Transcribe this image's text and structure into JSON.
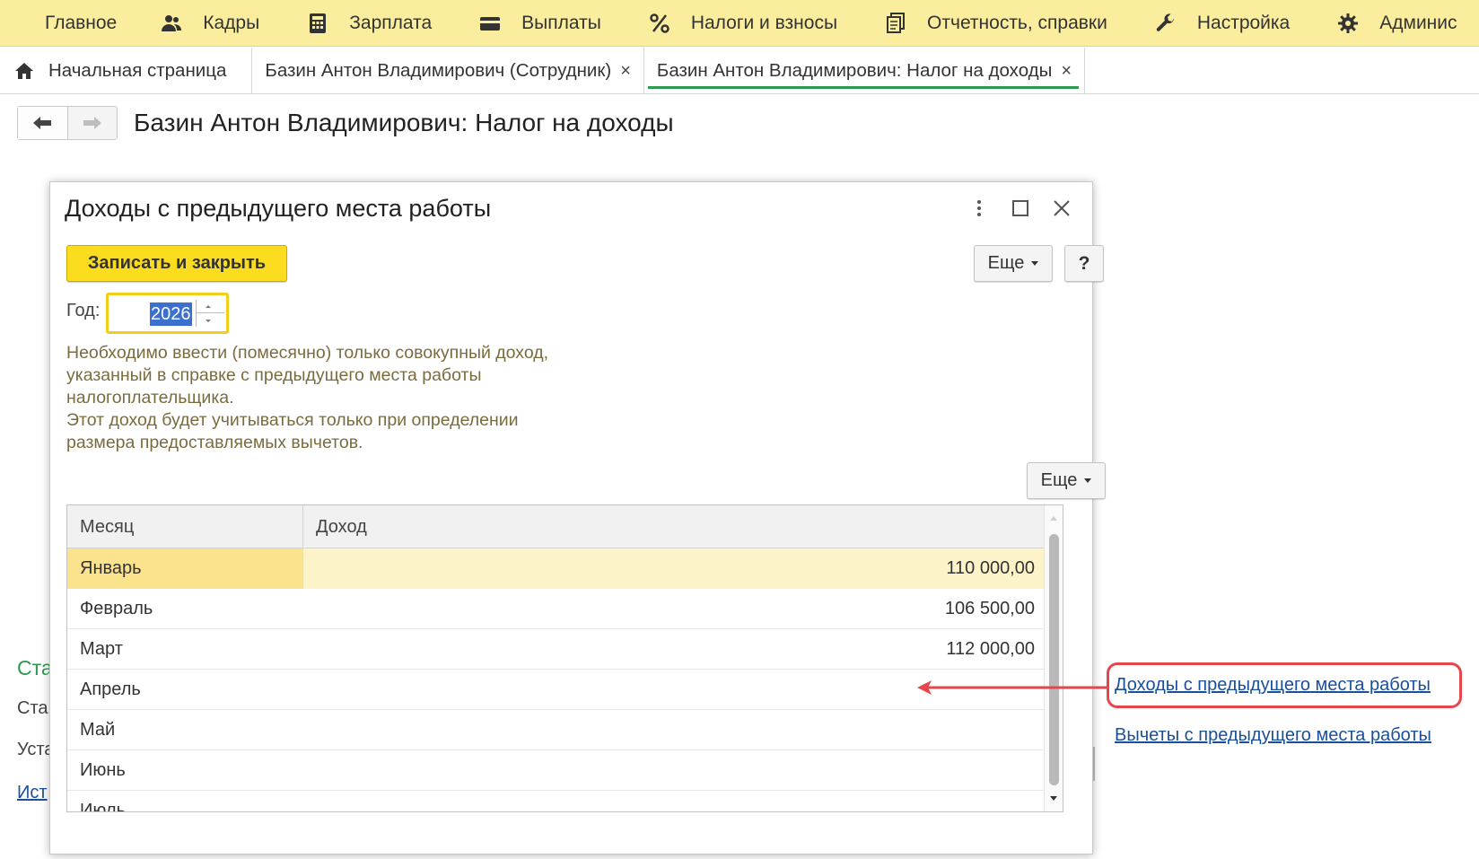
{
  "menu": {
    "items": [
      {
        "label": "Главное",
        "icon": "hamburger-icon"
      },
      {
        "label": "Кадры",
        "icon": "people-icon"
      },
      {
        "label": "Зарплата",
        "icon": "calculator-icon"
      },
      {
        "label": "Выплаты",
        "icon": "wallet-icon"
      },
      {
        "label": "Налоги и взносы",
        "icon": "percent-icon"
      },
      {
        "label": "Отчетность, справки",
        "icon": "documents-icon"
      },
      {
        "label": "Настройка",
        "icon": "wrench-icon"
      },
      {
        "label": "Админис",
        "icon": "gear-icon"
      }
    ]
  },
  "tabs": [
    {
      "label": "Начальная страница",
      "icon": "home-icon"
    },
    {
      "label": "Базин Антон Владимирович (Сотрудник)",
      "close": "×"
    },
    {
      "label": "Базин Антон Владимирович: Налог на доходы",
      "close": "×",
      "active": true
    }
  ],
  "page": {
    "title": "Базин Антон Владимирович: Налог на доходы"
  },
  "background": {
    "frag1": "Ста",
    "frag2": "Ста",
    "frag3": "Уста",
    "frag4": "Ист"
  },
  "side_links": {
    "income_prev_job": "Доходы с предыдущего места работы",
    "deductions_prev_job": "Вычеты с предыдущего места работы"
  },
  "dialog": {
    "title": "Доходы с предыдущего места работы",
    "save_close_label": "Записать и закрыть",
    "more_label": "Еще",
    "help_label": "?",
    "year_label": "Год:",
    "year_value": "2026",
    "info_lines": [
      "Необходимо ввести (помесячно) только совокупный доход,",
      "указанный в справке с предыдущего места работы",
      "налогоплательщика.",
      "Этот доход будет учитываться только при определении",
      "размера предоставляемых вычетов."
    ],
    "table_more_label": "Еще",
    "table": {
      "columns": [
        "Месяц",
        "Доход"
      ],
      "rows": [
        {
          "month": "Январь",
          "income": "110 000,00",
          "selected": true
        },
        {
          "month": "Февраль",
          "income": "106 500,00"
        },
        {
          "month": "Март",
          "income": "112 000,00"
        },
        {
          "month": "Апрель",
          "income": ""
        },
        {
          "month": "Май",
          "income": ""
        },
        {
          "month": "Июнь",
          "income": ""
        },
        {
          "month": "Июль",
          "income": ""
        }
      ]
    }
  },
  "colors": {
    "menubar": "#fbed9e",
    "accent_yellow": "#fbdc1f",
    "active_tab_underline": "#2e9a4f",
    "link": "#1a4f9c",
    "callout_red": "#e4464e",
    "info_text": "#7a6c3e"
  }
}
